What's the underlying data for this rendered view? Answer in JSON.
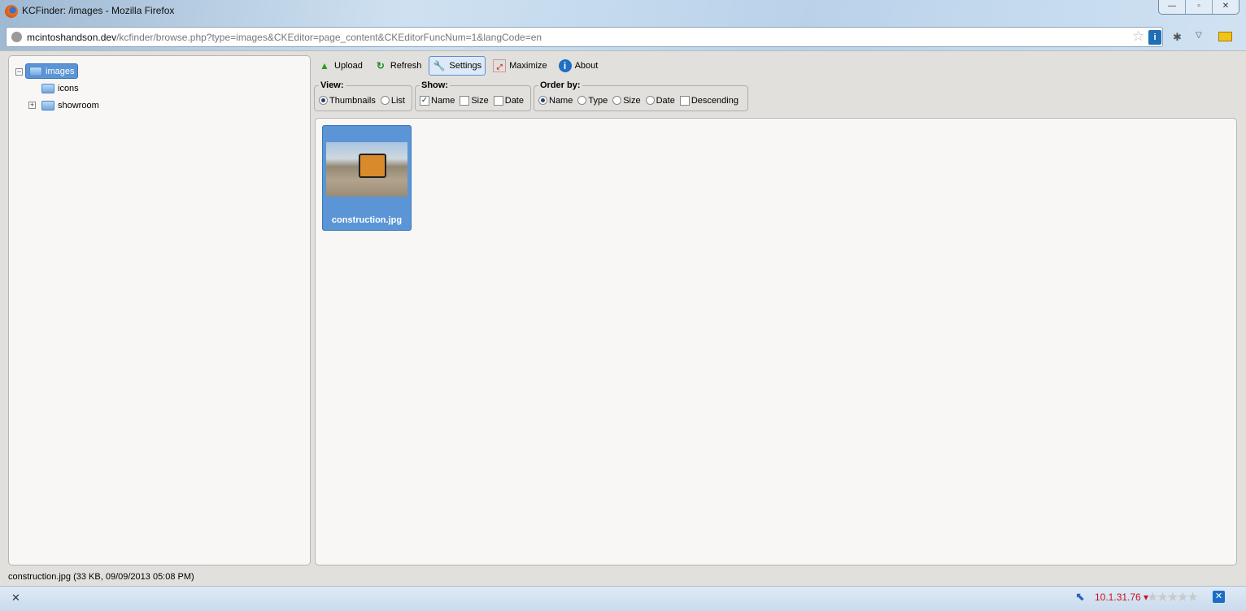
{
  "window": {
    "title": "KCFinder: /images - Mozilla Firefox",
    "buttons": {
      "minimize": "—",
      "restore": "▫",
      "close": "✕"
    }
  },
  "urlbar": {
    "domain": "mcintoshandson.dev",
    "path": "/kcfinder/browse.php?type=images&CKEditor=page_content&CKEditorFuncNum=1&langCode=en"
  },
  "tree": {
    "items": [
      {
        "label": "images",
        "selected": true,
        "expanded": true
      },
      {
        "label": "icons"
      },
      {
        "label": "showroom",
        "expandable": true
      }
    ]
  },
  "toolbar": {
    "upload": "Upload",
    "refresh": "Refresh",
    "settings": "Settings",
    "maximize": "Maximize",
    "about": "About"
  },
  "view": {
    "legend": "View:",
    "thumbnails": "Thumbnails",
    "list": "List",
    "selected": "Thumbnails"
  },
  "show": {
    "legend": "Show:",
    "name": "Name",
    "size": "Size",
    "date": "Date",
    "checked": [
      "Name"
    ]
  },
  "order": {
    "legend": "Order by:",
    "name": "Name",
    "type": "Type",
    "size": "Size",
    "date": "Date",
    "descending": "Descending",
    "selected": "Name"
  },
  "files": [
    {
      "name": "construction.jpg",
      "selected": true
    }
  ],
  "status": "construction.jpg (33 KB, 09/09/2013 05:08 PM)",
  "addonbar": {
    "close": "✕",
    "ip": "10.1.31.76 ▾",
    "rating": "★★★★★"
  },
  "colors": {
    "selection": "#5b95d6",
    "ip": "#d0101a"
  }
}
